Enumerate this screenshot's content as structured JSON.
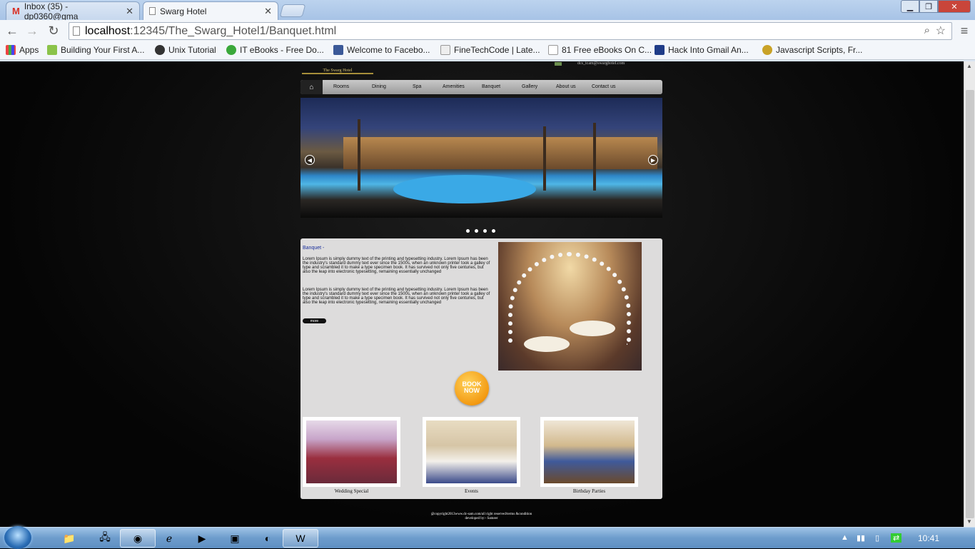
{
  "browser": {
    "tabs": [
      {
        "title": "Inbox (35) - dp0360@gma",
        "icon": "gmail-icon"
      },
      {
        "title": "Swarg Hotel",
        "icon": "page-icon"
      }
    ],
    "url_host": "localhost",
    "url_path": ":12345/The_Swarg_Hotel1/Banquet.html",
    "bookmarks": [
      "Apps",
      "Building Your First A...",
      "Unix Tutorial",
      "IT eBooks - Free Do...",
      "Welcome to Facebo...",
      "FineTechCode | Late...",
      "81 Free eBooks On C...",
      "Hack Into Gmail An...",
      "Javascript Scripts, Fr..."
    ]
  },
  "site": {
    "logo_text": "The Swarg Hotel",
    "email": "dcs_tcam@swarghotel.com",
    "menu": [
      "Rooms",
      "Dining",
      "Spa",
      "Amenities",
      "Banquet",
      "Gallery",
      "About us",
      "Contact us"
    ],
    "section_title": "Banquet -",
    "para1": "Lorem Ipsum is simply dummy text of the printing and typesetting industry. Lorem Ipsum has been the industry's standard dummy text ever since the 1500s, when an unknown printer took a galley of type and scrambled it to make a type specimen book. It has survived not only five centuries, but also the leap into electronic typesetting, remaining essentially unchanged",
    "para2": "Lorem Ipsum is simply dummy text of the printing and typesetting industry. Lorem Ipsum has been the industry's standard dummy text ever since the 1500s, when an unknown printer took a galley of type and scrambled it to make a type specimen book. It has survived not only five centuries, but also the leap into electronic typesetting, remaining essentially unchanged",
    "more_label": "more",
    "book_now": "BOOK NOW",
    "thumbs": [
      "Wedding Special",
      "Events",
      "Birthday Parties"
    ],
    "footer_line1": "@copyright2013www.dc-sam.com/all right reserved/terms &condition",
    "footer_line2": "developed by:- Sameer"
  },
  "taskbar": {
    "time": "10:41"
  }
}
